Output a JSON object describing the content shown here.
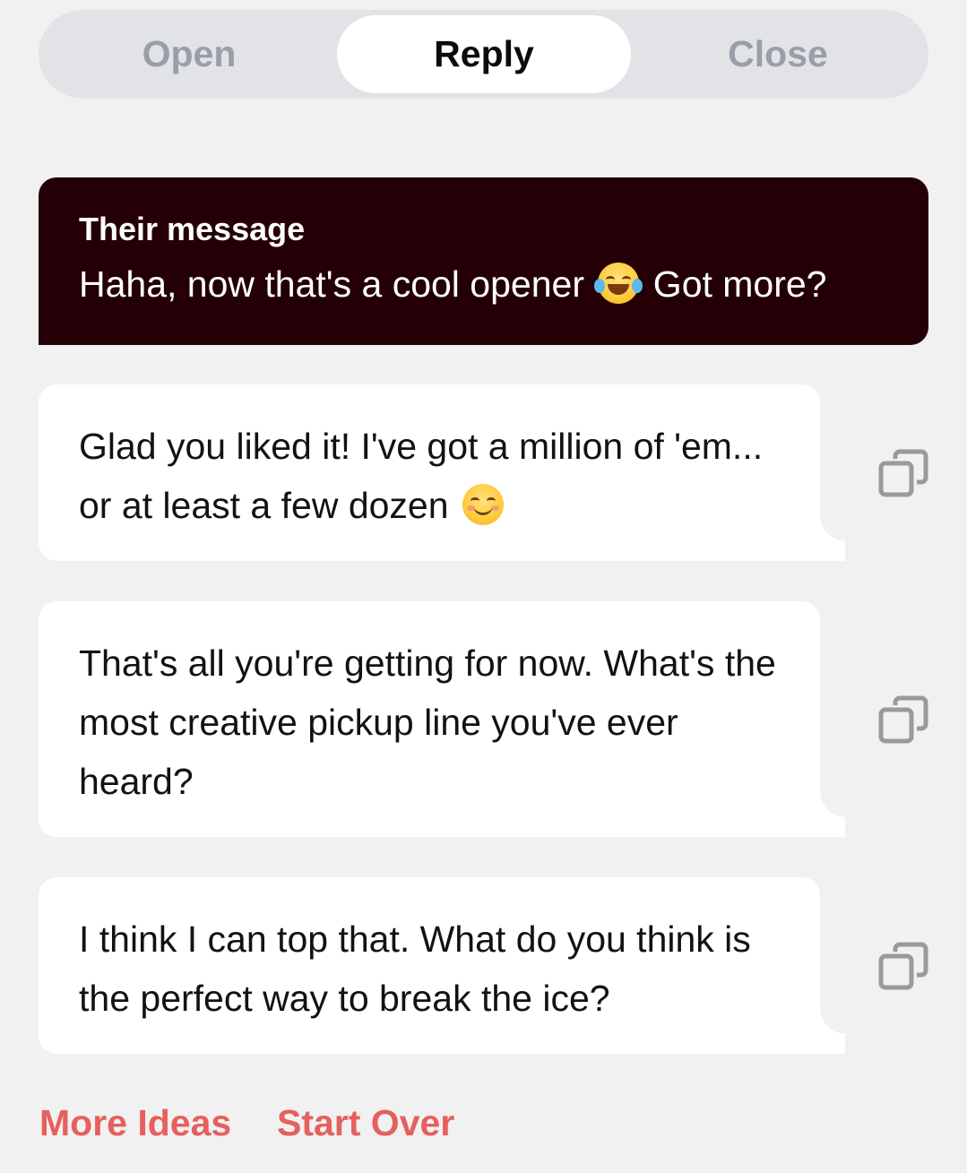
{
  "tabs": {
    "open_label": "Open",
    "reply_label": "Reply",
    "close_label": "Close",
    "selected": "Reply"
  },
  "their_message": {
    "label": "Their message",
    "text_before_emoji": "Haha, now that's a cool opener",
    "emoji": "face-with-tears-of-joy",
    "text_after_emoji": "Got more?"
  },
  "suggestions": [
    {
      "text": "Glad you liked it! I've got a million of 'em... or at least a few dozen",
      "emoji": "smiling-face-with-smiling-eyes"
    },
    {
      "text": "That's all you're getting for now. What's the most creative pickup line you've ever heard?"
    },
    {
      "text": "I think I can top that. What do you think is the perfect way to break the ice?"
    }
  ],
  "footer": {
    "more_ideas_label": "More Ideas",
    "start_over_label": "Start Over"
  },
  "colors": {
    "background": "#f1f1f1",
    "their_card": "#240006",
    "accent": "#e5605e",
    "segment_track": "#e2e3e7",
    "inactive_tab_text": "#9a9ea8",
    "copy_icon": "#9a9a9a"
  }
}
